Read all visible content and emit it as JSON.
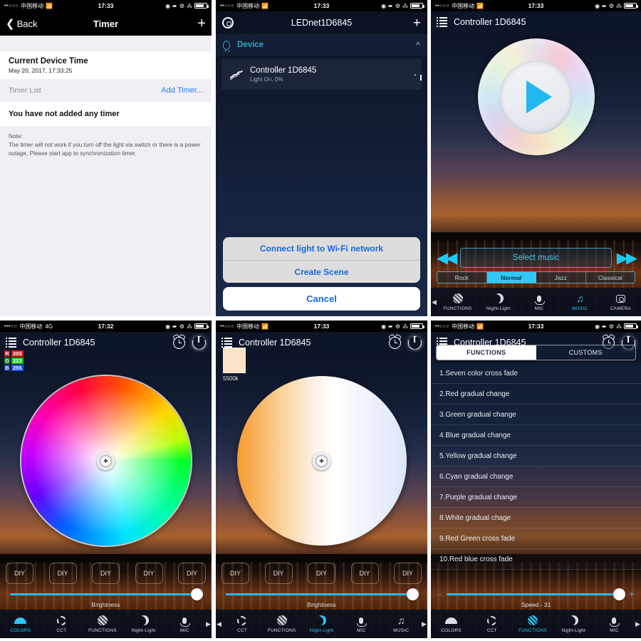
{
  "status_bar": {
    "dots": "••○○○",
    "dots_4g": "•••○○",
    "carrier": "中国移动",
    "wifi_icon": "wifi-icon",
    "network_4g": "4G",
    "time_1733": "17:33",
    "time_1732": "17:32",
    "right_icons": [
      "alarm-icon",
      "location-icon",
      "rotation-lock-icon",
      "bluetooth-icon",
      "battery-icon"
    ]
  },
  "panel_timer": {
    "nav": {
      "back_label": "Back",
      "title": "Timer",
      "add_icon": "plus-icon"
    },
    "current_time": {
      "label": "Current Device Time",
      "value": "May 20, 2017, 17:33:25"
    },
    "timer_list": {
      "label": "Timer List",
      "action": "Add Timer..."
    },
    "empty_text": "You have not added any timer",
    "note": {
      "title": "Note:",
      "body": "The timer will not work if you turn off the light via switch or there is a power outage, Please start app to synchronization timer."
    }
  },
  "panel_devices": {
    "nav": {
      "gear_icon": "gear-icon",
      "title": "LEDnet1D6845",
      "add_icon": "plus-icon"
    },
    "section": {
      "icon": "bulb-icon",
      "label": "Device",
      "collapse_icon": "chevron-up-icon"
    },
    "device": {
      "icon": "led-strip-icon",
      "name": "Controller 1D6845",
      "status": "Light On, 0%",
      "power_icon": "power-icon"
    },
    "action_sheet": {
      "items": [
        "Connect light to Wi-Fi network",
        "Create Scene"
      ],
      "cancel": "Cancel"
    }
  },
  "panel_music": {
    "nav": {
      "menu_icon": "hamburger-icon",
      "title": "Controller 1D6845"
    },
    "disc": {
      "play_icon": "play-icon"
    },
    "controls": {
      "prev_icon": "rewind-icon",
      "select_label": "Select music",
      "next_icon": "fast-forward-icon"
    },
    "modes": [
      {
        "label": "Rock",
        "selected": false
      },
      {
        "label": "Normal",
        "selected": true
      },
      {
        "label": "Jazz",
        "selected": false
      },
      {
        "label": "Classical",
        "selected": false
      }
    ],
    "tabs": [
      {
        "label": "FUNCTIONS",
        "icon": "functions-icon",
        "active": false
      },
      {
        "label": "Night-Light",
        "icon": "moon-icon",
        "active": false
      },
      {
        "label": "MIC",
        "icon": "mic-icon",
        "active": false
      },
      {
        "label": "MUSIC",
        "icon": "music-note-icon",
        "active": true
      },
      {
        "label": "CAMERA",
        "icon": "camera-icon",
        "active": false
      }
    ],
    "scroll_left_icon": "triangle-left-icon"
  },
  "panel_colors": {
    "nav": {
      "menu_icon": "hamburger-icon",
      "title": "Controller 1D6845",
      "alarm_icon": "alarm-icon",
      "power_icon": "power-icon"
    },
    "rgb": {
      "r_key": "R",
      "r_value": "203",
      "g_key": "G",
      "g_value": "223",
      "b_key": "B",
      "b_value": "255"
    },
    "wheel": {
      "cursor_icon": "crosshair-cursor"
    },
    "diy_buttons": [
      "DIY",
      "DIY",
      "DIY",
      "DIY",
      "DIY"
    ],
    "brightness_label": "Brightness",
    "tabs": [
      {
        "label": "COLORS",
        "icon": "colors-icon",
        "active": true
      },
      {
        "label": "CCT",
        "icon": "cct-icon",
        "active": false
      },
      {
        "label": "FUNCTIONS",
        "icon": "functions-icon",
        "active": false
      },
      {
        "label": "Night-Light",
        "icon": "moon-icon",
        "active": false
      },
      {
        "label": "MIC",
        "icon": "mic-icon",
        "active": false
      }
    ],
    "scroll_right_icon": "triangle-right-icon"
  },
  "panel_cct": {
    "nav": {
      "menu_icon": "hamburger-icon",
      "title": "Controller 1D6845",
      "alarm_icon": "alarm-icon",
      "power_icon": "power-icon"
    },
    "swatch": {
      "label": "5500k",
      "color": "#fbe2c8"
    },
    "wheel": {
      "cursor_icon": "crosshair-cursor"
    },
    "diy_buttons": [
      "DIY",
      "DIY",
      "DIY",
      "DIY",
      "DIY"
    ],
    "brightness_label": "Brightness",
    "tabs": [
      {
        "label": "CCT",
        "icon": "cct-icon",
        "active": false
      },
      {
        "label": "FUNCTIONS",
        "icon": "functions-icon",
        "active": false
      },
      {
        "label": "Night-Light",
        "icon": "moon-icon",
        "active": true
      },
      {
        "label": "MIC",
        "icon": "mic-icon",
        "active": false
      },
      {
        "label": "MUSIC",
        "icon": "music-note-icon",
        "active": false
      }
    ],
    "scroll_left_icon": "triangle-left-icon",
    "scroll_right_icon": "triangle-right-icon"
  },
  "panel_functions": {
    "nav": {
      "menu_icon": "hamburger-icon",
      "title": "Controller 1D6845",
      "alarm_icon": "alarm-icon",
      "power_icon": "power-icon"
    },
    "segments": [
      {
        "label": "FUNCTIONS",
        "selected": true
      },
      {
        "label": "CUSTOMS",
        "selected": false
      }
    ],
    "items": [
      "1.Seven color cross fade",
      "2.Red gradual change",
      "3.Green gradual change",
      "4.Blue gradual change",
      "5.Yellow gradual change",
      "6.Cyan gradual change",
      "7.Purple gradual change",
      "8.White gradual chage",
      "9.Red Green cross fade",
      "10.Red blue cross fade"
    ],
    "speed": {
      "minus": "-",
      "plus": "+",
      "label": "Speed - 31",
      "value": 31
    },
    "tabs": [
      {
        "label": "COLORS",
        "icon": "colors-icon",
        "active": false
      },
      {
        "label": "CCT",
        "icon": "cct-icon",
        "active": false
      },
      {
        "label": "FUNCTIONS",
        "icon": "functions-icon",
        "active": true
      },
      {
        "label": "Night-Light",
        "icon": "moon-icon",
        "active": false
      },
      {
        "label": "MIC",
        "icon": "mic-icon",
        "active": false
      }
    ],
    "scroll_right_icon": "triangle-right-icon"
  },
  "theme": {
    "accent_cyan": "#2fc4f2",
    "ios_blue": "#1569e0",
    "dark_navy": "#0e162a"
  }
}
